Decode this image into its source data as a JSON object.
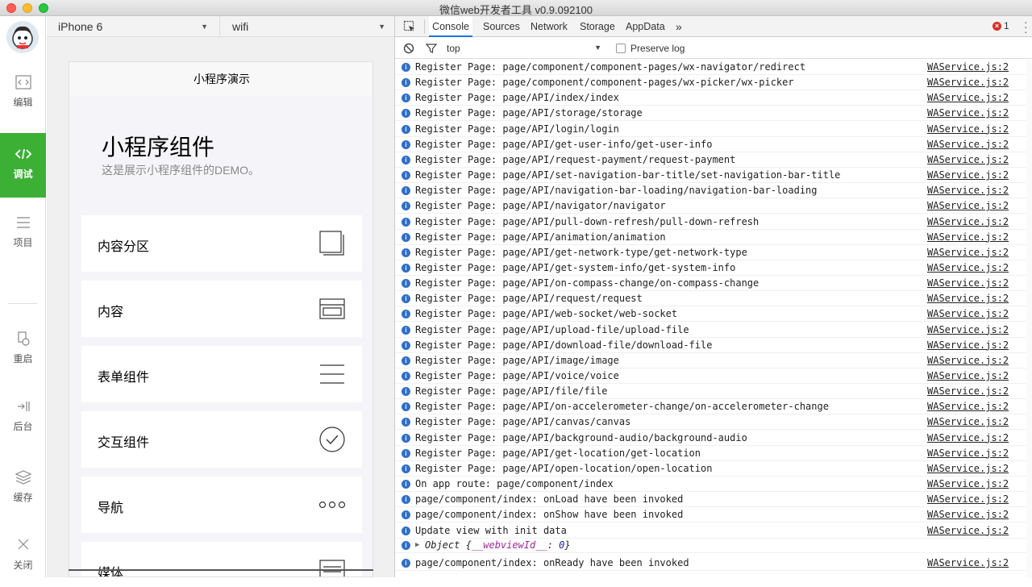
{
  "window": {
    "title": "微信web开发者工具 v0.9.092100"
  },
  "sidebar": {
    "items": [
      {
        "label": "编辑",
        "icon": "code-icon"
      },
      {
        "label": "调试",
        "icon": "code-icon"
      },
      {
        "label": "项目",
        "icon": "menu-icon"
      },
      {
        "label": "重启",
        "icon": "restart-icon"
      },
      {
        "label": "后台",
        "icon": "background-icon"
      },
      {
        "label": "缓存",
        "icon": "layers-icon"
      },
      {
        "label": "关闭",
        "icon": "close-icon"
      }
    ],
    "active": "调试"
  },
  "simulator": {
    "device": "iPhone 6",
    "network": "wifi",
    "nav_title": "小程序演示",
    "title": "小程序组件",
    "subtitle": "这是展示小程序组件的DEMO。",
    "cards": [
      {
        "label": "内容分区",
        "icon": "copy-icon"
      },
      {
        "label": "内容",
        "icon": "content-icon"
      },
      {
        "label": "表单组件",
        "icon": "list-icon"
      },
      {
        "label": "交互组件",
        "icon": "check-circle-icon"
      },
      {
        "label": "导航",
        "icon": "more-icon"
      },
      {
        "label": "媒体",
        "icon": "media-icon"
      }
    ]
  },
  "devtools": {
    "tabs": [
      "Console",
      "Sources",
      "Network",
      "Storage",
      "AppData"
    ],
    "more": "»",
    "active_tab": "Console",
    "error_count": "1",
    "context": "top",
    "preserve_log": "Preserve log",
    "logs": [
      {
        "msg": "Register Page: page/component/component-pages/wx-navigator/redirect",
        "src": "WAService.js:2"
      },
      {
        "msg": "Register Page: page/component/component-pages/wx-picker/wx-picker",
        "src": "WAService.js:2"
      },
      {
        "msg": "Register Page: page/API/index/index",
        "src": "WAService.js:2"
      },
      {
        "msg": "Register Page: page/API/storage/storage",
        "src": "WAService.js:2"
      },
      {
        "msg": "Register Page: page/API/login/login",
        "src": "WAService.js:2"
      },
      {
        "msg": "Register Page: page/API/get-user-info/get-user-info",
        "src": "WAService.js:2"
      },
      {
        "msg": "Register Page: page/API/request-payment/request-payment",
        "src": "WAService.js:2"
      },
      {
        "msg": "Register Page: page/API/set-navigation-bar-title/set-navigation-bar-title",
        "src": "WAService.js:2"
      },
      {
        "msg": "Register Page: page/API/navigation-bar-loading/navigation-bar-loading",
        "src": "WAService.js:2"
      },
      {
        "msg": "Register Page: page/API/navigator/navigator",
        "src": "WAService.js:2"
      },
      {
        "msg": "Register Page: page/API/pull-down-refresh/pull-down-refresh",
        "src": "WAService.js:2"
      },
      {
        "msg": "Register Page: page/API/animation/animation",
        "src": "WAService.js:2"
      },
      {
        "msg": "Register Page: page/API/get-network-type/get-network-type",
        "src": "WAService.js:2"
      },
      {
        "msg": "Register Page: page/API/get-system-info/get-system-info",
        "src": "WAService.js:2"
      },
      {
        "msg": "Register Page: page/API/on-compass-change/on-compass-change",
        "src": "WAService.js:2"
      },
      {
        "msg": "Register Page: page/API/request/request",
        "src": "WAService.js:2"
      },
      {
        "msg": "Register Page: page/API/web-socket/web-socket",
        "src": "WAService.js:2"
      },
      {
        "msg": "Register Page: page/API/upload-file/upload-file",
        "src": "WAService.js:2"
      },
      {
        "msg": "Register Page: page/API/download-file/download-file",
        "src": "WAService.js:2"
      },
      {
        "msg": "Register Page: page/API/image/image",
        "src": "WAService.js:2"
      },
      {
        "msg": "Register Page: page/API/voice/voice",
        "src": "WAService.js:2"
      },
      {
        "msg": "Register Page: page/API/file/file",
        "src": "WAService.js:2"
      },
      {
        "msg": "Register Page: page/API/on-accelerometer-change/on-accelerometer-change",
        "src": "WAService.js:2"
      },
      {
        "msg": "Register Page: page/API/canvas/canvas",
        "src": "WAService.js:2"
      },
      {
        "msg": "Register Page: page/API/background-audio/background-audio",
        "src": "WAService.js:2"
      },
      {
        "msg": "Register Page: page/API/get-location/get-location",
        "src": "WAService.js:2"
      },
      {
        "msg": "Register Page: page/API/open-location/open-location",
        "src": "WAService.js:2"
      },
      {
        "msg": "On app route: page/component/index",
        "src": "WAService.js:2"
      },
      {
        "msg": "page/component/index: onLoad have been invoked",
        "src": "WAService.js:2"
      },
      {
        "msg": "page/component/index: onShow have been invoked",
        "src": "WAService.js:2"
      },
      {
        "msg": "Update view with init data",
        "src": "WAService.js:2"
      }
    ],
    "object_line": {
      "prefix": "Object {",
      "key": "__webviewId__",
      "sep": ": ",
      "value": "0",
      "suffix": "}"
    },
    "last_log": {
      "msg": "page/component/index: onReady have been invoked",
      "src": "WAService.js:2"
    }
  },
  "colors": {
    "accent": "#3cb035",
    "info": "#2f6ecb",
    "error": "#d93025"
  }
}
